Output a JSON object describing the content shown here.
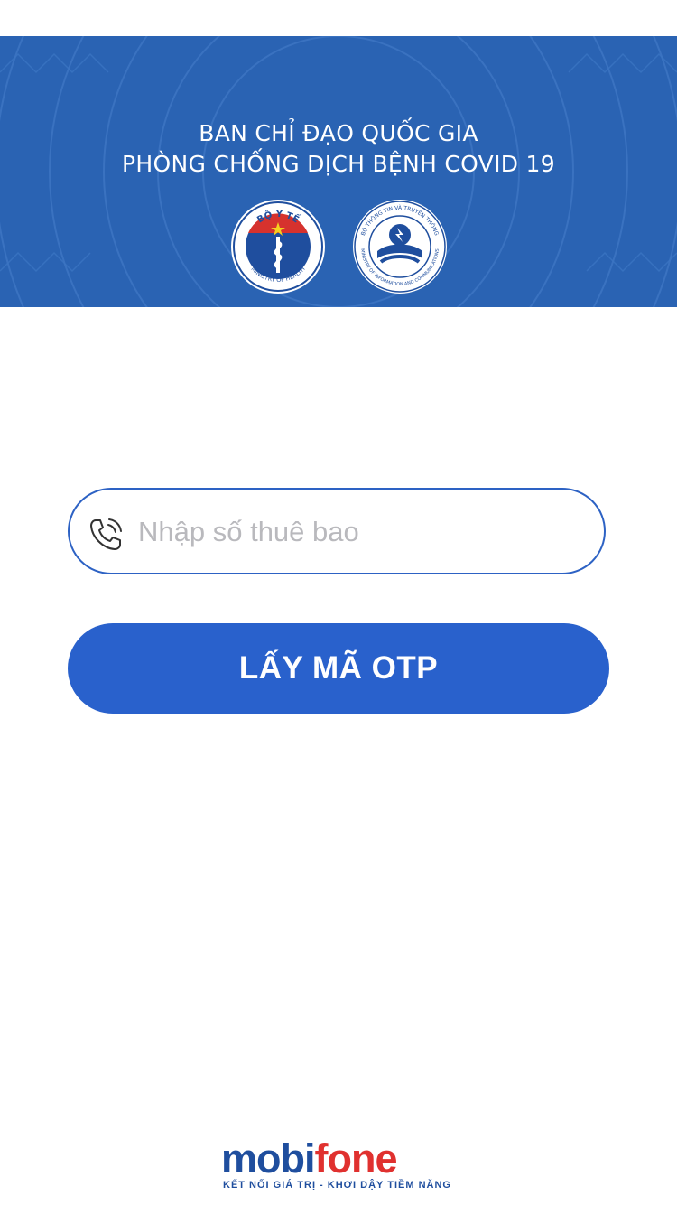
{
  "banner": {
    "title_line1": "BAN CHỈ ĐẠO QUỐC GIA",
    "title_line2": "PHÒNG CHỐNG DỊCH BỆNH COVID 19",
    "background_color": "#2a63b3",
    "emblems": [
      {
        "name": "ministry-of-health-emblem",
        "top_text": "BỘ Y TẾ",
        "bottom_text": "MINISTRY OF HEALTH"
      },
      {
        "name": "ministry-of-information-emblem",
        "top_text": "BỘ THÔNG TIN VÀ TRUYỀN THÔNG",
        "bottom_text": "MINISTRY OF INFORMATION AND COMMUNICATIONS"
      }
    ]
  },
  "form": {
    "phone_icon": "phone-icon",
    "phone_placeholder": "Nhập số thuê bao",
    "phone_value": "",
    "submit_label": "LẤY MÃ OTP",
    "accent_color": "#2961cc"
  },
  "footer": {
    "logo_part1": "mobi",
    "logo_part2": "fone",
    "tagline": "KẾT NỐI GIÁ TRỊ - KHƠI DẬY TIỀM NĂNG",
    "brand_blue": "#1f4e9e",
    "brand_red": "#e0312f"
  }
}
